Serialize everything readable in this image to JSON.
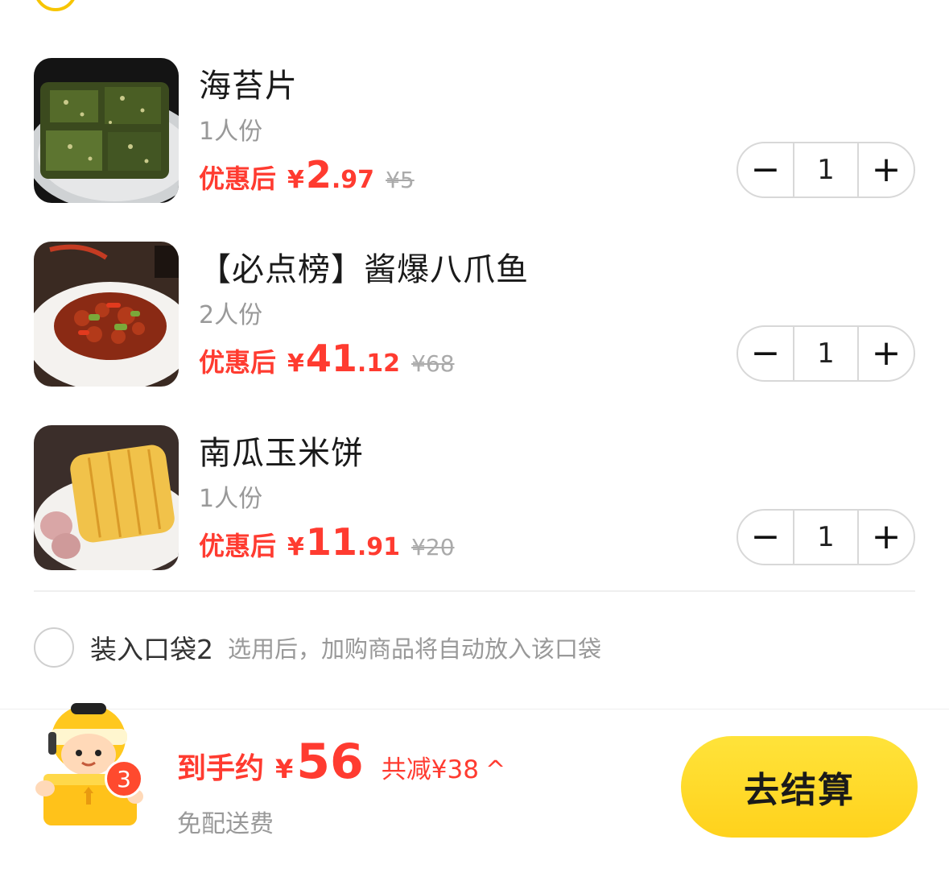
{
  "top_partial": {
    "text": ""
  },
  "items": [
    {
      "name": "海苔片",
      "portion": "1人份",
      "price_label": "优惠后",
      "currency": "¥",
      "price_int": "2",
      "price_dec": ".97",
      "original_price": "¥5",
      "quantity": "1"
    },
    {
      "name": "【必点榜】酱爆八爪鱼",
      "portion": "2人份",
      "price_label": "优惠后",
      "currency": "¥",
      "price_int": "41",
      "price_dec": ".12",
      "original_price": "¥68",
      "quantity": "1"
    },
    {
      "name": "南瓜玉米饼",
      "portion": "1人份",
      "price_label": "优惠后",
      "currency": "¥",
      "price_int": "11",
      "price_dec": ".91",
      "original_price": "¥20",
      "quantity": "1"
    }
  ],
  "stepper": {
    "minus": "−",
    "plus": "+"
  },
  "bag2": {
    "label": "装入口袋2",
    "hint": "选用后，加购商品将自动放入该口袋"
  },
  "bottom": {
    "cart_count": "3",
    "total_label": "到手约",
    "currency": "¥",
    "total_amount": "56",
    "saved_text": "共减¥38",
    "chevron": "^",
    "delivery": "免配送费",
    "checkout_label": "去结算"
  },
  "colors": {
    "accent_red": "#ff3b30",
    "checkout_yellow": "#ffd21c",
    "radio_yellow": "#f7c500"
  }
}
